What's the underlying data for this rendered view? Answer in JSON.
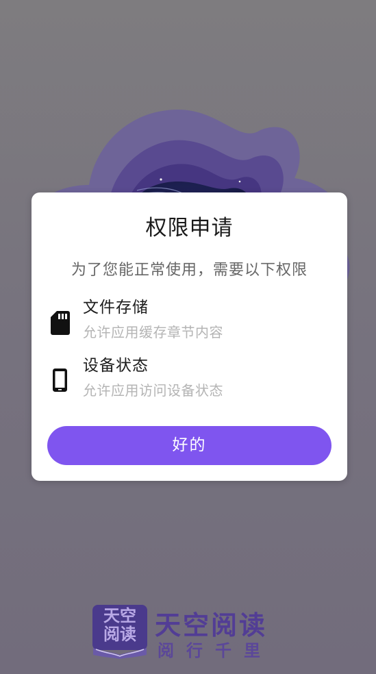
{
  "dialog": {
    "title": "权限申请",
    "subtitle": "为了您能正常使用，需要以下权限",
    "permissions": [
      {
        "icon": "sd-card-icon",
        "name": "文件存储",
        "description": "允许应用缓存章节内容"
      },
      {
        "icon": "phone-icon",
        "name": "设备状态",
        "description": "允许应用访问设备状态"
      }
    ],
    "confirm_label": "好的"
  },
  "brand": {
    "logo_text": "天空阅读",
    "name": "天空阅读",
    "slogan": "阅行千里"
  },
  "colors": {
    "accent": "#7f55ef",
    "brand_text": "#523d95",
    "background": "#858288"
  }
}
